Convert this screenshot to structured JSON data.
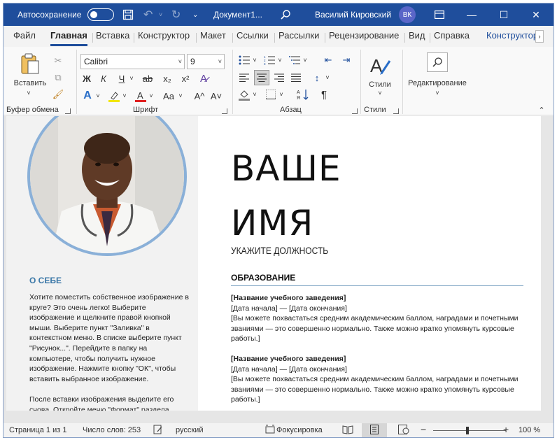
{
  "titlebar": {
    "autosave_label": "Автосохранение",
    "doc_title": "Документ1...",
    "user_name": "Василий Кировский",
    "user_initials": "ВК"
  },
  "tabs": [
    "Файл",
    "Главная",
    "Вставка",
    "Конструктор",
    "Макет",
    "Ссылки",
    "Рассылки",
    "Рецензирование",
    "Вид",
    "Справка",
    "Конструктор"
  ],
  "ribbon": {
    "clipboard": {
      "paste_label": "Вставить",
      "group_label": "Буфер обмена"
    },
    "font": {
      "font_name": "Calibri",
      "font_size": "9",
      "bold": "Ж",
      "italic": "К",
      "underline": "Ч",
      "strike": "ab",
      "subscript": "x₂",
      "superscript": "x²",
      "change_case": "Aa",
      "grow": "A^",
      "shrink": "A˅",
      "group_label": "Шрифт"
    },
    "paragraph": {
      "group_label": "Абзац",
      "pilcrow": "¶"
    },
    "styles": {
      "label": "Стили",
      "group_label": "Стили"
    },
    "editing": {
      "label": "Редактирование"
    }
  },
  "document": {
    "about_title": "О СЕБЕ",
    "about_text": "Хотите поместить собственное изображение в круге? Это очень легко! Выберите изображение и щелкните правой кнопкой мыши. Выберите пункт \"Заливка\" в контекстном меню. В списке выберите пункт \"Рисунок...\". Перейдите в папку на компьютере, чтобы получить нужное изображение. Нажмите кнопку \"ОК\", чтобы вставить выбранное изображение.\n\nПосле вставки изображения выделите его снова. Откройте меню \"Формат\" раздела",
    "name_line1": "ВАШЕ",
    "name_line2": "ИМЯ",
    "job_title": "УКАЖИТЕ ДОЛЖНОСТЬ",
    "education_title": "ОБРАЗОВАНИЕ",
    "entries": [
      {
        "school": "[Название учебного заведения]",
        "dates": "[Дата начала] — [Дата окончания]",
        "desc": "[Вы можете похвастаться средним академическим баллом, наградами и почетными званиями — это совершенно нормально. Также можно кратко упомянуть курсовые работы.]"
      },
      {
        "school": "[Название учебного заведения]",
        "dates": "[Дата начала] — [Дата окончания]",
        "desc": "[Вы можете похвастаться средним академическим баллом, наградами и почетными званиями — это совершенно нормально. Также можно кратко упомянуть курсовые работы.]"
      }
    ]
  },
  "statusbar": {
    "page": "Страница 1 из 1",
    "words": "Число слов: 253",
    "language": "русский",
    "focus": "Фокусировка",
    "zoom": "100 %"
  },
  "colors": {
    "titlebar": "#1f4e9c",
    "accent_blue": "#3b78a8",
    "photo_ring": "#8ab0d8"
  }
}
